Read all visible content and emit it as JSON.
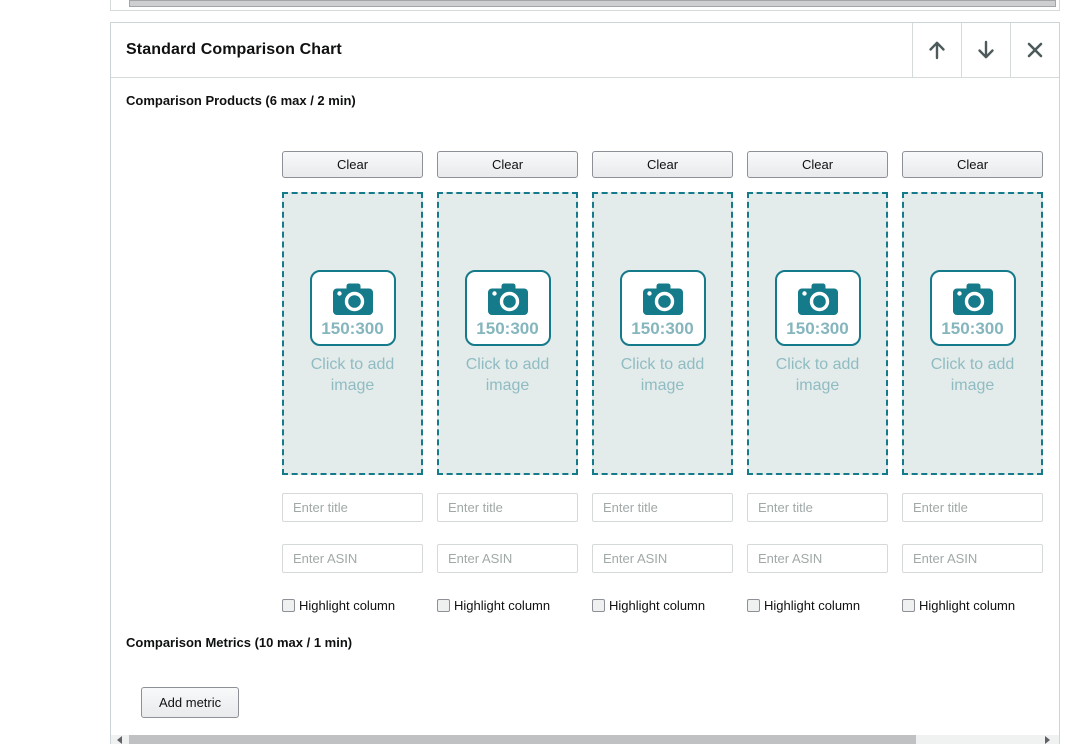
{
  "module": {
    "title": "Standard Comparison Chart",
    "controls": {
      "move_up": "arrow-up-icon",
      "move_down": "arrow-down-icon",
      "close": "close-icon"
    }
  },
  "products_section": {
    "label": "Comparison Products (6 max / 2 min)",
    "columns": [
      {
        "clear_label": "Clear",
        "image_ratio": "150:300",
        "image_prompt": "Click to add image",
        "title_placeholder": "Enter title",
        "asin_placeholder": "Enter ASIN",
        "highlight_label": "Highlight column"
      },
      {
        "clear_label": "Clear",
        "image_ratio": "150:300",
        "image_prompt": "Click to add image",
        "title_placeholder": "Enter title",
        "asin_placeholder": "Enter ASIN",
        "highlight_label": "Highlight column"
      },
      {
        "clear_label": "Clear",
        "image_ratio": "150:300",
        "image_prompt": "Click to add image",
        "title_placeholder": "Enter title",
        "asin_placeholder": "Enter ASIN",
        "highlight_label": "Highlight column"
      },
      {
        "clear_label": "Clear",
        "image_ratio": "150:300",
        "image_prompt": "Click to add image",
        "title_placeholder": "Enter title",
        "asin_placeholder": "Enter ASIN",
        "highlight_label": "Highlight column"
      },
      {
        "clear_label": "Clear",
        "image_ratio": "150:300",
        "image_prompt": "Click to add image",
        "title_placeholder": "Enter title",
        "asin_placeholder": "Enter ASIN",
        "highlight_label": "Highlight column"
      }
    ]
  },
  "metrics_section": {
    "label": "Comparison Metrics (10 max / 1 min)",
    "add_metric_label": "Add metric"
  },
  "colors": {
    "teal": "#157a8a",
    "dropzone_bg": "#e4ebeb",
    "muted_teal_text": "#8fbcc2",
    "border_gray": "#d5dbdb",
    "icon_gray": "#4d5a5c"
  }
}
